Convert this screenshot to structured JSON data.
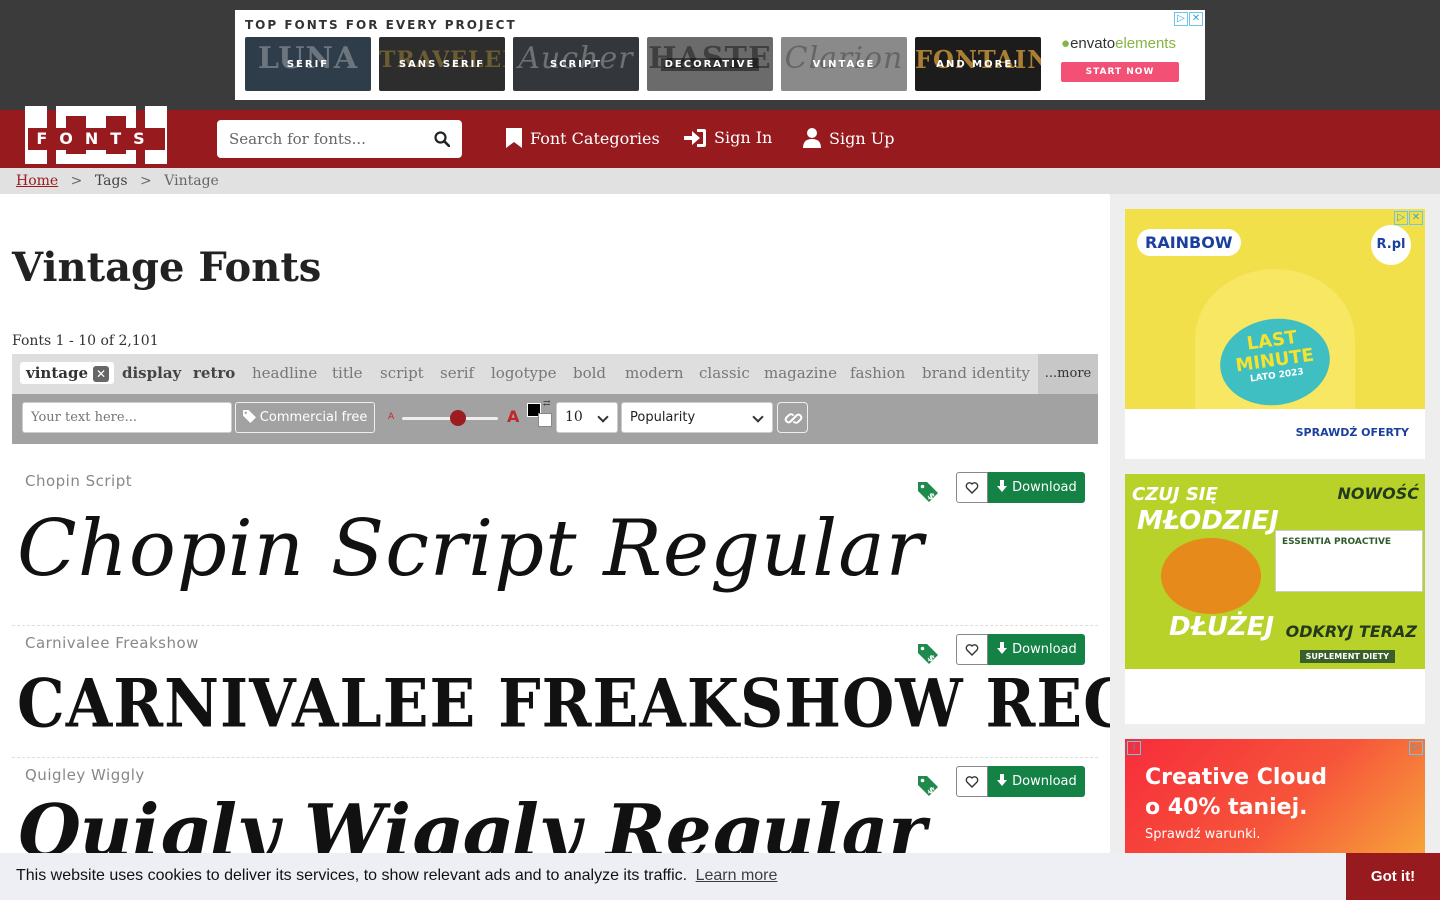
{
  "top_ad": {
    "title": "TOP FONTS FOR EVERY PROJECT",
    "tiles": [
      {
        "label": "SERIF",
        "bg": "LUNA",
        "color": "#2f3d4a"
      },
      {
        "label": "SANS SERIF",
        "bg": "TRAVELER",
        "color": "#2d2d2d"
      },
      {
        "label": "SCRIPT",
        "bg": "Aucher",
        "color": "#33363b"
      },
      {
        "label": "DECORATIVE",
        "bg": "HASTE",
        "color": "#6b6b6b"
      },
      {
        "label": "VINTAGE",
        "bg": "Clarion",
        "color": "#8a8a8a"
      },
      {
        "label": "AND MORE!",
        "bg": "FONTAINE",
        "color": "#1c1c1c"
      }
    ],
    "envato_brand": "envato",
    "envato_product": "elements",
    "envato_cta": "START NOW"
  },
  "nav": {
    "logo_digits": "1001",
    "logo_text": "FONTS",
    "search_placeholder": "Search for fonts...",
    "categories": "Font Categories",
    "sign_in": "Sign In",
    "sign_up": "Sign Up"
  },
  "breadcrumb": {
    "home": "Home",
    "tags": "Tags",
    "current": "Vintage",
    "separator": ">"
  },
  "main": {
    "title": "Vintage Fonts",
    "count": "Fonts 1 - 10 of 2,101",
    "active_tag": "vintage",
    "tags": [
      {
        "label": "display",
        "strong": true
      },
      {
        "label": "retro",
        "strong": true
      },
      {
        "label": "headline",
        "strong": false
      },
      {
        "label": "title",
        "strong": false
      },
      {
        "label": "script",
        "strong": false
      },
      {
        "label": "serif",
        "strong": false
      },
      {
        "label": "logotype",
        "strong": false
      },
      {
        "label": "bold",
        "strong": false
      },
      {
        "label": "modern",
        "strong": false
      },
      {
        "label": "classic",
        "strong": false
      },
      {
        "label": "magazine",
        "strong": false
      },
      {
        "label": "fashion",
        "strong": false
      },
      {
        "label": "brand identity",
        "strong": false
      }
    ],
    "more": "...more"
  },
  "controls": {
    "text_placeholder": "Your text here...",
    "commercial_free": "Commercial free",
    "size_small": "A",
    "size_big": "A",
    "per_page": "10",
    "sort": "Popularity",
    "font_size_level_percent": 58
  },
  "fonts": [
    {
      "name": "Chopin Script",
      "preview": "Chopin Script Regular",
      "style": "script",
      "download": "Download"
    },
    {
      "name": "Carnivalee Freakshow",
      "preview": "CARNIVALEE FREAKSHOW REGULAR",
      "style": "western",
      "download": "Download"
    },
    {
      "name": "Quigley Wiggly",
      "preview": "Quigly Wiggly Regular",
      "style": "wiggly",
      "download": "Download"
    }
  ],
  "sidebar_ads": {
    "rainbow": {
      "brand": "RAINBOW",
      "badge": "R.pl",
      "headline_1": "LAST",
      "headline_2": "MINUTE",
      "sub": "LATO 2023",
      "cta": "SPRAWDŹ OFERTY"
    },
    "essentia": {
      "line1": "CZUJ SIĘ",
      "line2": "MŁODZIEJ",
      "line3": "DŁUŻEJ",
      "badge": "NOWOŚĆ",
      "product": "ESSENTIA PROACTIVE",
      "cta": "ODKRYJ TERAZ",
      "tag": "SUPLEMENT DIETY"
    },
    "adobe": {
      "line1": "Creative Cloud",
      "line2": "o 40% taniej.",
      "line3": "Sprawdź warunki."
    }
  },
  "cookie": {
    "message": "This website uses cookies to deliver its services, to show relevant ads and to analyze its traffic.",
    "learn_more": "Learn more",
    "button": "Got it!"
  },
  "colors": {
    "brand_red": "#961a1e",
    "download_green": "#148145",
    "tag_green": "#1e8a4c"
  }
}
